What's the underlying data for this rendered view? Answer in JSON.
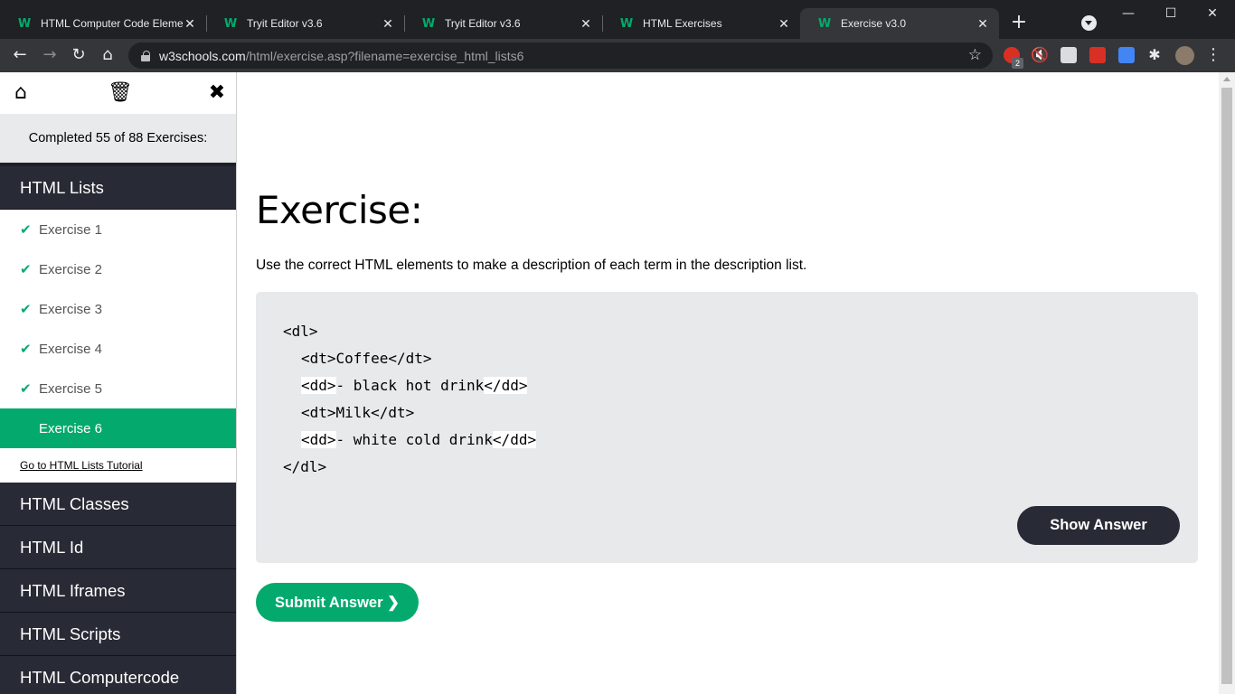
{
  "browser": {
    "tabs": [
      {
        "title": "HTML Computer Code Eleme",
        "active": false
      },
      {
        "title": "Tryit Editor v3.6",
        "active": false
      },
      {
        "title": "Tryit Editor v3.6",
        "active": false
      },
      {
        "title": "HTML Exercises",
        "active": false
      },
      {
        "title": "Exercise v3.0",
        "active": true
      }
    ],
    "url_host": "w3schools.com",
    "url_path": "/html/exercise.asp?filename=exercise_html_lists6",
    "extension_badge": "2"
  },
  "sidebar": {
    "progress": "Completed 55 of 88 Exercises:",
    "current_topic": "HTML Lists",
    "exercises": [
      {
        "label": "Exercise 1",
        "completed": true
      },
      {
        "label": "Exercise 2",
        "completed": true
      },
      {
        "label": "Exercise 3",
        "completed": true
      },
      {
        "label": "Exercise 4",
        "completed": true
      },
      {
        "label": "Exercise 5",
        "completed": true
      },
      {
        "label": "Exercise 6",
        "completed": false
      }
    ],
    "tutorial_link": "Go to HTML Lists Tutorial",
    "topics": [
      "HTML Classes",
      "HTML Id",
      "HTML Iframes",
      "HTML Scripts",
      "HTML Computercode"
    ]
  },
  "main": {
    "heading": "Exercise:",
    "instruction": "Use the correct HTML elements to make a description of each term in the description list.",
    "code": {
      "line1": "<dl>",
      "line2": "<dt>Coffee</dt>",
      "line3_open": "<dd>",
      "line3_text": "- black hot drink",
      "line3_close": "</dd>",
      "line4": "<dt>Milk</dt>",
      "line5_open": "<dd>",
      "line5_text": "- white cold drink",
      "line5_close": "</dd>",
      "line6": "</dl>"
    },
    "show_answer_label": "Show Answer",
    "submit_label": "Submit Answer ❯"
  },
  "colors": {
    "accent": "#04aa6d",
    "dark": "#282a35",
    "codebox_bg": "#e7e9eb"
  }
}
